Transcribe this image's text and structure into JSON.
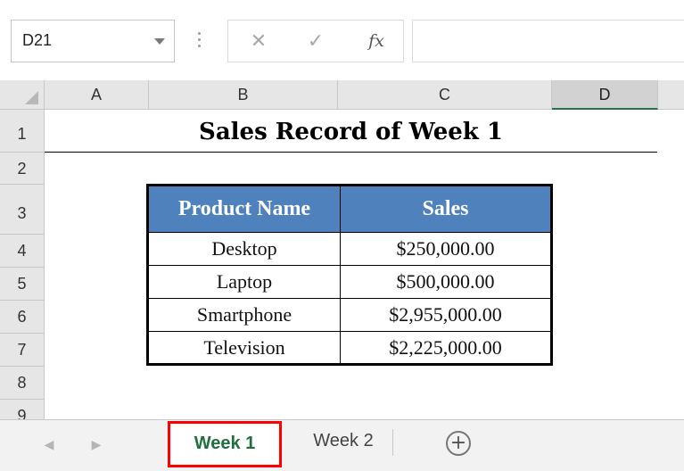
{
  "formula_bar": {
    "name_box": "D21",
    "cancel_icon": "✕",
    "enter_icon": "✓",
    "fx_label": "fx",
    "formula_value": ""
  },
  "columns": [
    "A",
    "B",
    "C",
    "D"
  ],
  "selected_column": "D",
  "rows": [
    "1",
    "2",
    "3",
    "4",
    "5",
    "6",
    "7",
    "8",
    "9"
  ],
  "sheet": {
    "title": "Sales Record of Week 1",
    "table": {
      "headers": [
        "Product Name",
        "Sales"
      ],
      "rows": [
        [
          "Desktop",
          "$250,000.00"
        ],
        [
          "Laptop",
          "$500,000.00"
        ],
        [
          "Smartphone",
          "$2,955,000.00"
        ],
        [
          "Television",
          "$2,225,000.00"
        ]
      ],
      "header_color": "#4f81bd"
    }
  },
  "tabs": {
    "items": [
      "Week 1",
      "Week 2"
    ],
    "active": "Week 1",
    "add_icon": "+",
    "prev_icon": "◀",
    "next_icon": "▶",
    "highlight_color": "#ff0000"
  }
}
